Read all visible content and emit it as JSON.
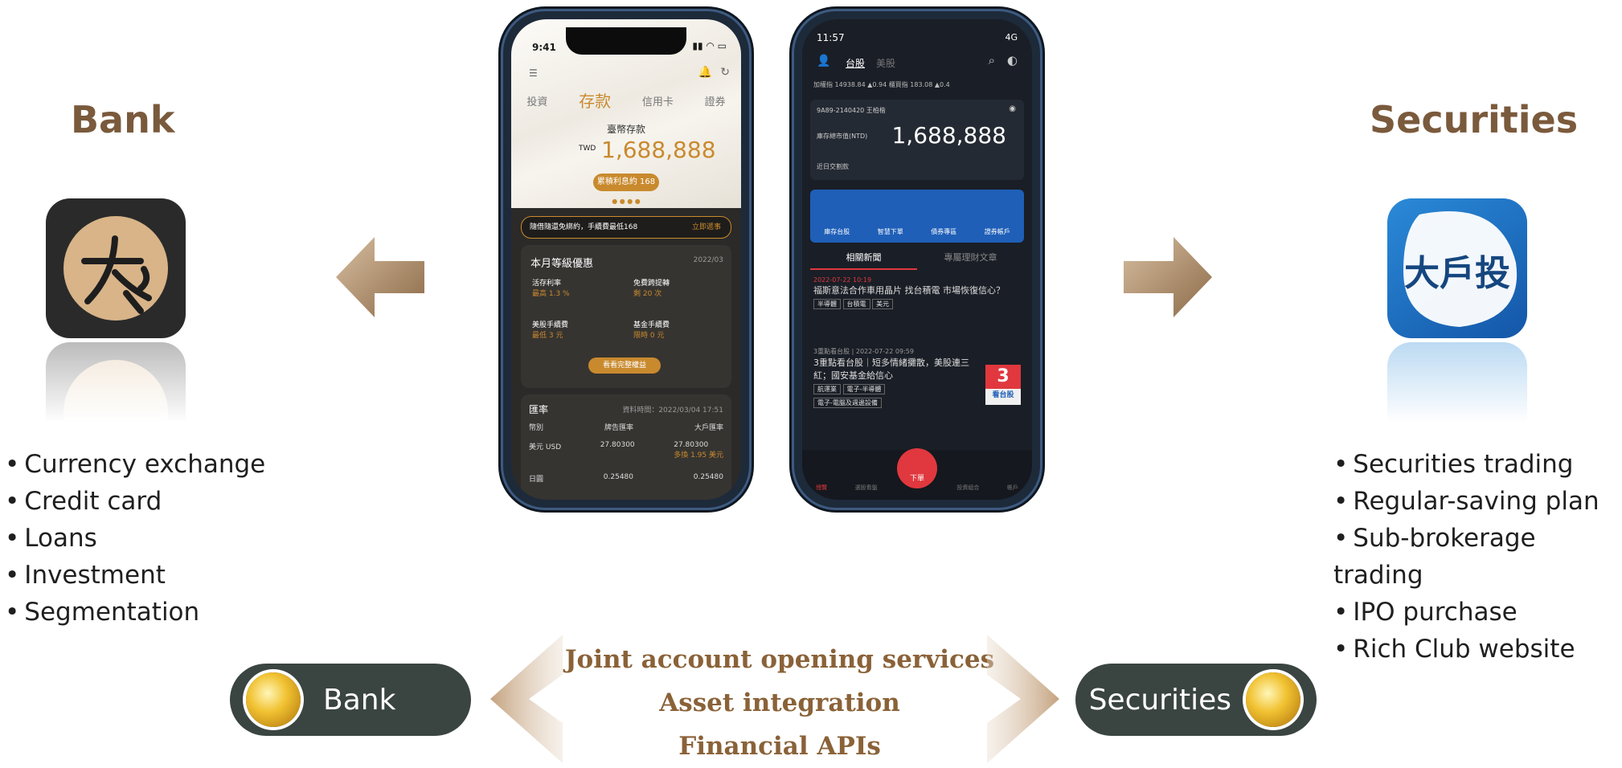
{
  "left": {
    "title": "Bank",
    "features": [
      "Currency exchange",
      "Credit card",
      "Loans",
      "Investment",
      "Segmentation"
    ]
  },
  "right": {
    "title": "Securities",
    "features": [
      "Securities trading",
      "Regular-saving plan",
      "Sub-brokerage trading",
      "IPO purchase",
      "Rich Club website"
    ]
  },
  "bank_phone": {
    "time": "9:41",
    "tabs": [
      "投資",
      "存款",
      "信用卡",
      "證券"
    ],
    "balance_label": "臺幣存款",
    "currency": "TWD",
    "balance": "1,688,888",
    "pill": "累積利息約 168",
    "promo": "隨借隨還免綁約，手續費最低168",
    "promo_cta": "立即遞事",
    "section_title": "本月等級優惠",
    "section_date": "2022/03",
    "perks": [
      {
        "label": "活存利率",
        "value": "最高 1.3 %"
      },
      {
        "label": "免費跨提轉",
        "value": "剩 20 次"
      },
      {
        "label": "美股手續費",
        "value": "最低 3 元"
      },
      {
        "label": "基金手續費",
        "value": "限時 0 元"
      }
    ],
    "perks_button": "看看完整權益",
    "fx_title": "匯率",
    "fx_time": "資料時間：2022/03/04 17:51",
    "fx_headers": [
      "幣別",
      "牌告匯率",
      "大戶匯率"
    ],
    "fx_rows": [
      {
        "cur": "美元",
        "code": "USD",
        "board": "27.80300",
        "vip": "27.80300",
        "note": "多換 1.95 美元"
      },
      {
        "cur": "日圓",
        "code": "",
        "board": "0.25480",
        "vip": "0.25480",
        "note": ""
      }
    ]
  },
  "sec_phone": {
    "time": "11:57",
    "signal": "4G",
    "tabs": [
      "台股",
      "美股"
    ],
    "ticker": "加權指 14938.84 ▲0.94  櫃買指 183.08 ▲0.4",
    "account": "9A89-2140420 王柏楷",
    "value_label": "庫存總市值(NTD)",
    "value": "1,688,888",
    "sub_label": "近日交割款",
    "actions": [
      "庫存台股",
      "智慧下單",
      "債券專區",
      "證券帳戶"
    ],
    "news_tabs": [
      "相關新聞",
      "專屬理財文章"
    ],
    "news": [
      {
        "date": "2022-07-22 10:19",
        "title": "福斯意法合作車用晶片 找台積電 市場恢復信心？",
        "tags": [
          "半導體",
          "台積電",
          "美元"
        ]
      },
      {
        "date": "3重點看台股 | 2022-07-22 09:59",
        "title": "3重點看台股｜短多情緒攤散，美股連三紅；國安基金給信心",
        "tags": [
          "航運業",
          "電子-半導體",
          "電子-電腦及週邊設備"
        ]
      }
    ],
    "badge_num": "3",
    "badge_text": "看台股",
    "nav": [
      "總覽",
      "選股看盤",
      "下單",
      "投資組合",
      "帳戶"
    ],
    "order_label": "下單"
  },
  "center": {
    "lines": [
      "Joint account opening services",
      "Asset integration",
      "Financial APIs"
    ]
  },
  "pills": {
    "left": "Bank",
    "right": "Securities"
  },
  "colors": {
    "title": "#7a5a3c",
    "arrow": "#a8896a",
    "pill_bg": "#3a4440",
    "center_text": "#8a6238"
  }
}
